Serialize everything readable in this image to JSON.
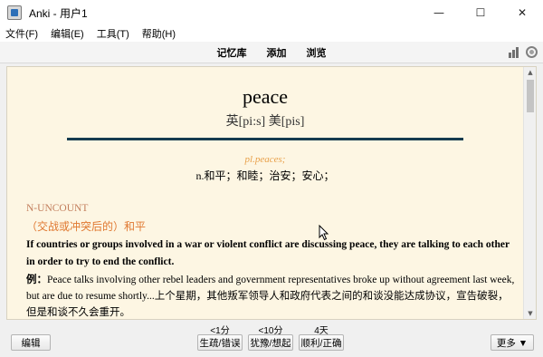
{
  "window": {
    "title": "Anki - 用户1",
    "minimize": "—",
    "maximize": "☐",
    "close": "✕"
  },
  "menu": [
    "文件(F)",
    "编辑(E)",
    "工具(T)",
    "帮助(H)"
  ],
  "toolbar": {
    "links": [
      "记忆库",
      "添加",
      "浏览"
    ],
    "icons": [
      "stats-icon",
      "sync-icon"
    ]
  },
  "card": {
    "word": "peace",
    "phonetic": "英[pi:s] 美[pis]",
    "plural": "pl.peaces;",
    "gloss": "n.和平；和睦；治安；安心；",
    "grammar": "N-UNCOUNT",
    "sense": "（交战或冲突后的）和平",
    "definition": "If countries or groups involved in a war or violent conflict are discussing peace, they are talking to each other in order to try to end the conflict.",
    "example_label": "例：",
    "example": "Peace talks involving other rebel leaders and government representatives broke up without agreement last week, but are due to resume shortly...上个星期，其他叛军领导人和政府代表之间的和谈没能达成协议，宣告破裂，但是和谈不久会重开。"
  },
  "scrollbar": {
    "up": "▲",
    "down": "▼"
  },
  "bottom": {
    "edit": "编辑",
    "intervals": [
      "<1分",
      "<10分",
      "4天"
    ],
    "answers": [
      "生疏/错误",
      "犹豫/想起",
      "顺利/正确"
    ],
    "more": "更多 ▼"
  },
  "colors": {
    "background": "#fdf6e3",
    "divider": "#153b4f",
    "plural": "#e8a04a",
    "sense": "#e07830",
    "grammar": "#c27e5c"
  }
}
